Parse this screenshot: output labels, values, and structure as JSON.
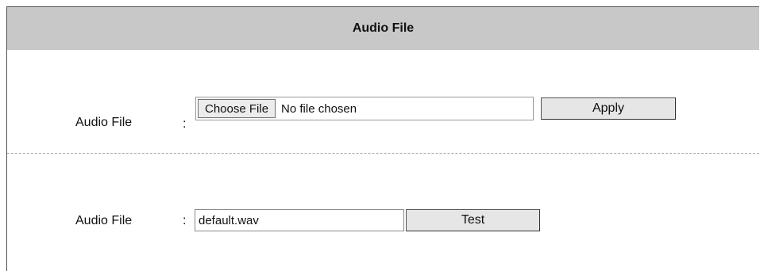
{
  "header": {
    "title": "Audio File"
  },
  "upload_row": {
    "label": "Audio File",
    "colon": ":",
    "choose_button_label": "Choose File",
    "file_status": "No file chosen",
    "apply_button_label": "Apply"
  },
  "current_row": {
    "label": "Audio File",
    "colon": ":",
    "file_value": "default.wav",
    "test_button_label": "Test"
  }
}
